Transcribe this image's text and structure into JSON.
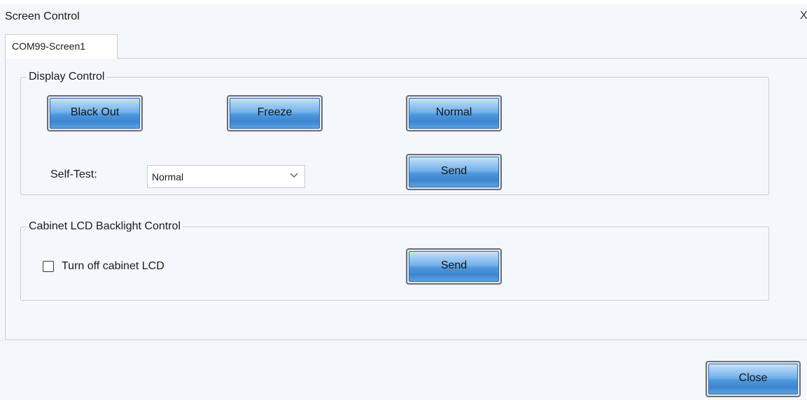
{
  "window": {
    "title": "Screen Control",
    "close_glyph": "X"
  },
  "tabs": [
    {
      "label": "COM99-Screen1",
      "selected": true
    }
  ],
  "display_control": {
    "title": "Display Control",
    "black_out_label": "Black Out",
    "freeze_label": "Freeze",
    "normal_label": "Normal",
    "self_test_label": "Self-Test:",
    "self_test_value": "Normal",
    "send_label": "Send"
  },
  "lcd_control": {
    "title": "Cabinet LCD Backlight Control",
    "checkbox_label": "Turn off cabinet LCD",
    "checkbox_checked": false,
    "send_label": "Send"
  },
  "footer": {
    "close_label": "Close"
  },
  "colors": {
    "button_blue": "#4d97dd",
    "background": "#f4f8fd"
  },
  "icons": {
    "dropdown": "chevron-down-icon",
    "window_close": "close-icon"
  }
}
